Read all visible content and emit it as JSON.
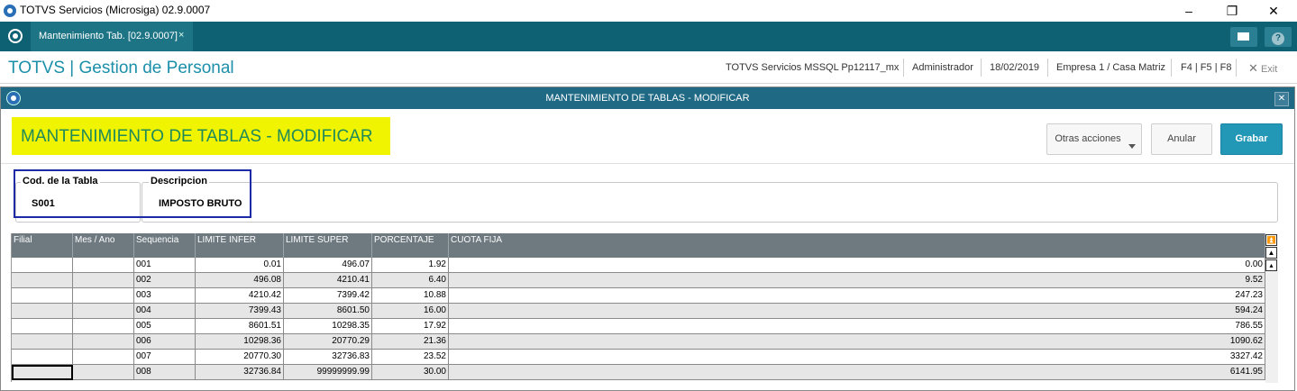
{
  "window": {
    "title": "TOTVS Servicios (Microsiga) 02.9.0007"
  },
  "tab": {
    "label": "Mantenimiento Tab. [02.9.0007]",
    "close": "×"
  },
  "header": {
    "brand": "TOTVS | Gestion de Personal",
    "server": "TOTVS Servicios MSSQL Pp12117_mx",
    "user": "Administrador",
    "date": "18/02/2019",
    "company": "Empresa 1 / Casa Matriz",
    "keys": "F4 | F5 | F8",
    "exit": "Exit"
  },
  "dialog": {
    "title": "MANTENIMIENTO DE TABLAS - MODIFICAR",
    "form_title": "MANTENIMIENTO DE TABLAS - MODIFICAR",
    "buttons": {
      "other": "Otras acciones",
      "cancel": "Anular",
      "save": "Grabar"
    },
    "fields": {
      "code_label": "Cod. de la Tabla",
      "code_value": "S001",
      "desc_label": "Descripcion",
      "desc_value": "IMPOSTO BRUTO"
    }
  },
  "grid": {
    "columns": [
      "Filial",
      "Mes / Ano",
      "Sequencia",
      "LIMITE INFER",
      "LIMITE SUPER",
      "PORCENTAJE",
      "CUOTA FIJA"
    ],
    "rows": [
      [
        "",
        "",
        "001",
        "0.01",
        "496.07",
        "1.92",
        "0.00"
      ],
      [
        "",
        "",
        "002",
        "496.08",
        "4210.41",
        "6.40",
        "9.52"
      ],
      [
        "",
        "",
        "003",
        "4210.42",
        "7399.42",
        "10.88",
        "247.23"
      ],
      [
        "",
        "",
        "004",
        "7399.43",
        "8601.50",
        "16.00",
        "594.24"
      ],
      [
        "",
        "",
        "005",
        "8601.51",
        "10298.35",
        "17.92",
        "786.55"
      ],
      [
        "",
        "",
        "006",
        "10298.36",
        "20770.29",
        "21.36",
        "1090.62"
      ],
      [
        "",
        "",
        "007",
        "20770.30",
        "32736.83",
        "23.52",
        "3327.42"
      ],
      [
        "",
        "",
        "008",
        "32736.84",
        "99999999.99",
        "30.00",
        "6141.95"
      ]
    ]
  },
  "icons": {
    "app": "totvs-logo-icon",
    "mail": "mail-icon",
    "help": "help-icon",
    "scroll_top": "scroll-top-icon",
    "scroll_page_up": "scroll-page-up-icon",
    "scroll_up": "scroll-up-icon"
  },
  "colors": {
    "tabbar": "#0e6173",
    "dialog_title": "#1f6985",
    "highlight_yellow": "#f1f400",
    "grid_header": "#6e7a80",
    "primary_button": "#2297b6"
  }
}
